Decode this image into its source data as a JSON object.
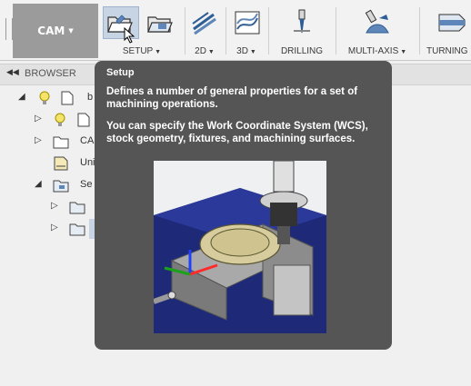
{
  "toolbar": {
    "workspace_label": "CAM",
    "tools": [
      {
        "id": "setup",
        "label": "SETUP"
      },
      {
        "id": "2d",
        "label": "2D"
      },
      {
        "id": "3d",
        "label": "3D"
      },
      {
        "id": "drilling",
        "label": "DRILLING"
      },
      {
        "id": "multi-axis",
        "label": "MULTI-AXIS"
      },
      {
        "id": "turning",
        "label": "TURNING"
      }
    ],
    "colors": {
      "workspace_bg": "#9b9b9b",
      "setup_active_bg": "#c7d4e4",
      "icon_blue": "#2f5d95"
    }
  },
  "browser": {
    "title": "BROWSER",
    "items": [
      {
        "text": "b",
        "icon": "bulb-icon"
      },
      {
        "text": "",
        "icon": "bulb-icon"
      },
      {
        "text": "CA",
        "icon": "folder-icon"
      },
      {
        "text": "Uni",
        "icon": "ruler-icon"
      },
      {
        "text": "Se",
        "icon": "setup-folder-icon"
      },
      {
        "text": "",
        "icon": "operation-icon"
      },
      {
        "text": "",
        "icon": "operation-icon"
      }
    ]
  },
  "tooltip": {
    "title": "Setup",
    "para1": "Defines a number of general properties for a set of machining operations.",
    "para2": "You can specify the Work Coordinate System (WCS), stock geometry, fixtures, and machining surfaces.",
    "bg_color": "#555555"
  }
}
